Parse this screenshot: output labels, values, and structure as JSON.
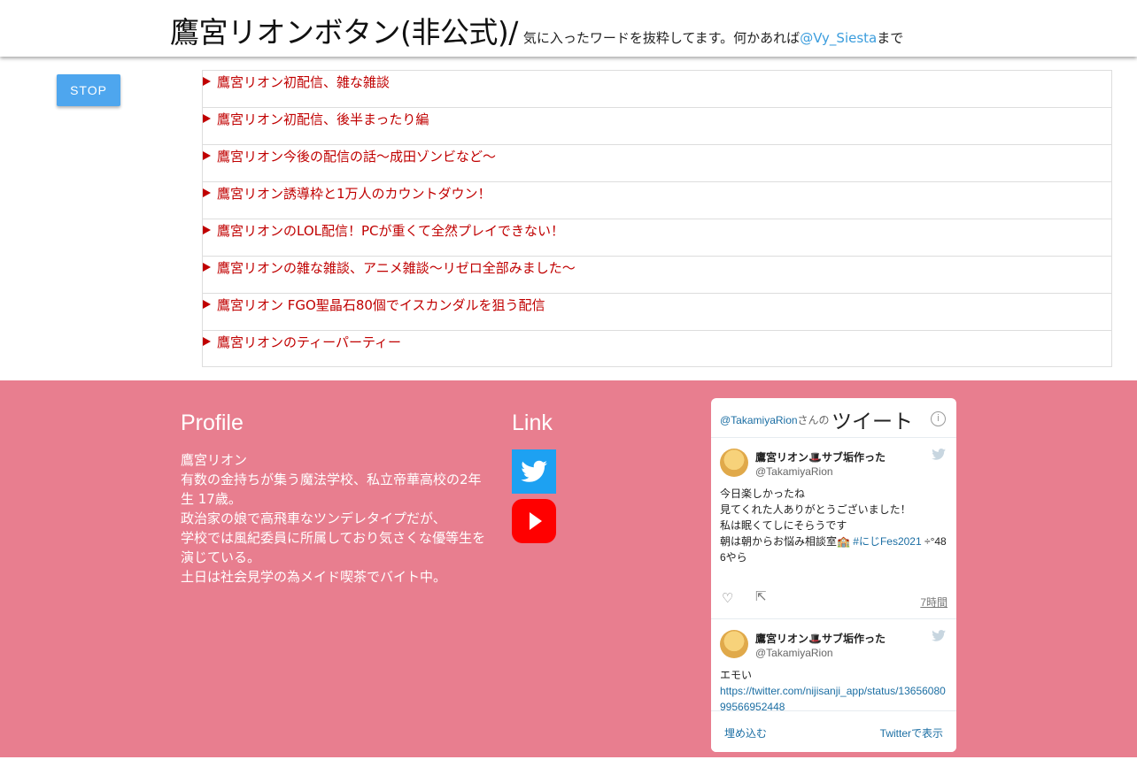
{
  "header": {
    "title": "鷹宮リオンボタン(非公式)/",
    "subtitle_prefix": "気に入ったワードを抜粋してます。何かあれば",
    "contact_handle": "@Vy_Siesta",
    "subtitle_suffix": "まで"
  },
  "controls": {
    "stop_label": "STOP",
    "accent": "#4ea6ee"
  },
  "episodes": [
    "鷹宮リオン初配信、雑な雑談",
    "鷹宮リオン初配信、後半まったり編",
    "鷹宮リオン今後の配信の話〜成田ゾンビなど〜",
    "鷹宮リオン誘導枠と1万人のカウントダウン！",
    "鷹宮リオンのLOL配信！PCが重くて全然プレイできない！",
    "鷹宮リオンの雑な雑談、アニメ雑談〜リゼロ全部みました〜",
    "鷹宮リオン FGO聖晶石80個でイスカンダルを狙う配信",
    "鷹宮リオンのティーパーティー"
  ],
  "footer": {
    "bg_color": "#e87e8f",
    "profile_heading": "Profile",
    "profile_lines": [
      "鷹宮リオン",
      "有数の金持ちが集う魔法学校、私立帝華高校の2年生 17歳。",
      "政治家の娘で高飛車なツンデレタイプだが、",
      "学校では風紀委員に所属しており気さくな優等生を演じている。",
      "土日は社会見学の為メイド喫茶でバイト中。"
    ],
    "link_heading": "Link",
    "links": [
      {
        "icon": "twitter-icon",
        "color": "#1da1f2"
      },
      {
        "icon": "youtube-icon",
        "color": "#ff0000"
      }
    ]
  },
  "timeline": {
    "handle": "@TakamiyaRion",
    "san": "さんの",
    "title": "ツイート",
    "info": "i",
    "tweets": [
      {
        "name": "鷹宮リオン🎩サブ垢作った",
        "handle": "@TakamiyaRion",
        "lines": [
          "今日楽しかったね",
          "見てくれた人ありがとうございました！",
          "私は眠くてしにそらうです"
        ],
        "last_line_text": "朝は朝からお悩み相談室🏫 ",
        "hashtag": "#にじFes2021",
        "last_line_tail": " ÷°486やら",
        "time": "7時間"
      },
      {
        "name": "鷹宮リオン🎩サブ垢作った",
        "handle": "@TakamiyaRion",
        "text": "エモい",
        "link": "https://twitter.com/nijisanji_app/status/1365608099566952448"
      }
    ],
    "embed_label": "埋め込む",
    "view_label": "Twitterで表示"
  }
}
